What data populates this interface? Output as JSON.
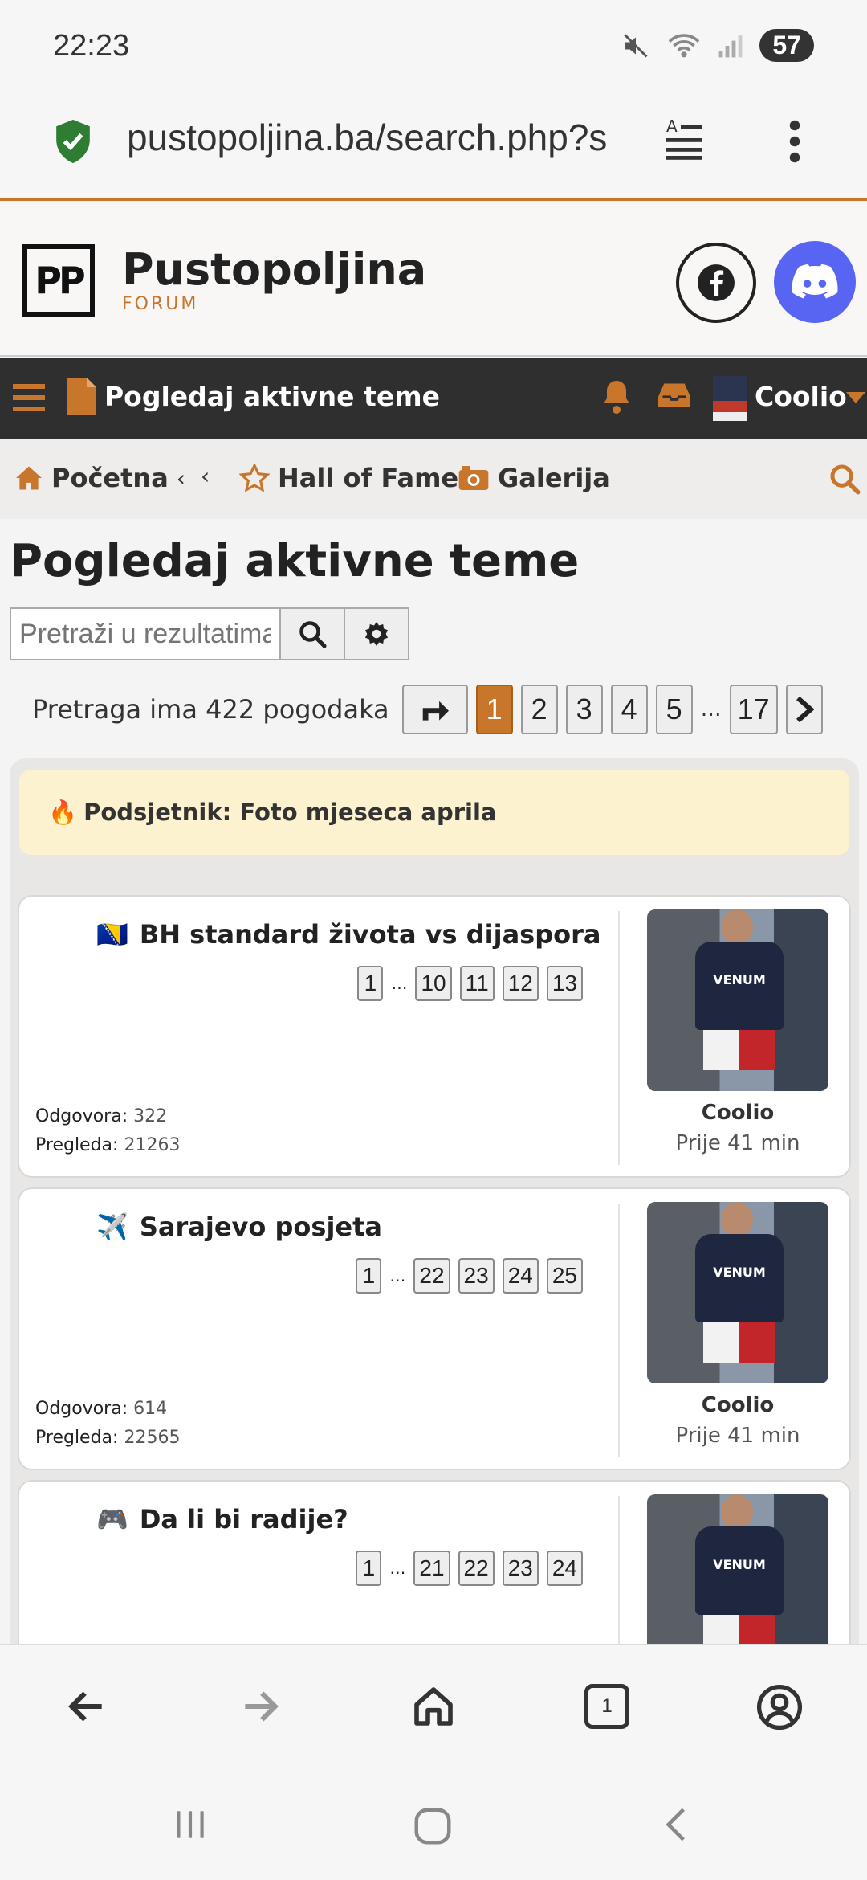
{
  "status": {
    "time": "22:23",
    "battery": "57"
  },
  "browser": {
    "url": "pustopoljina.ba/search.php?s",
    "tab_count": "1"
  },
  "site": {
    "logo_text": "PP",
    "name": "Pustopoljina",
    "subtitle": "FORUM"
  },
  "navbar": {
    "title": "Pogledaj aktivne teme",
    "username": "Coolio"
  },
  "breadcrumb": {
    "home": "Početna",
    "sep": "‹",
    "hall_of_fame": "Hall of Fame",
    "gallery": "Galerija"
  },
  "page": {
    "title": "Pogledaj aktivne teme",
    "search_placeholder": "Pretraži u rezultatima",
    "result_count": "Pretraga ima 422 pogodaka",
    "pages": [
      "1",
      "2",
      "3",
      "4",
      "5"
    ],
    "ellipsis": "…",
    "last_page": "17"
  },
  "notice": {
    "emoji": "🔥",
    "text": "Podsjetnik: Foto mjeseca aprila"
  },
  "topics": [
    {
      "emoji": "🇧🇦",
      "title": "BH standard života vs dijaspora",
      "pages": [
        "1",
        "10",
        "11",
        "12",
        "13"
      ],
      "replies_label": "Odgovora:",
      "replies": "322",
      "views_label": "Pregleda:",
      "views": "21263",
      "author": "Coolio",
      "ago": "Prije 41 min",
      "shirt": "VENUM"
    },
    {
      "emoji": "✈️",
      "title": "Sarajevo posjeta",
      "pages": [
        "1",
        "22",
        "23",
        "24",
        "25"
      ],
      "replies_label": "Odgovora:",
      "replies": "614",
      "views_label": "Pregleda:",
      "views": "22565",
      "author": "Coolio",
      "ago": "Prije 41 min",
      "shirt": "VENUM"
    },
    {
      "emoji": "🎮",
      "title": "Da li bi radije?",
      "pages": [
        "1",
        "21",
        "22",
        "23",
        "24"
      ],
      "shirt": "VENUM"
    }
  ],
  "colors": {
    "accent": "#c8762b",
    "navbar": "#2f2f2f",
    "discord": "#5865f2",
    "notice_bg": "#fdf2cf"
  }
}
